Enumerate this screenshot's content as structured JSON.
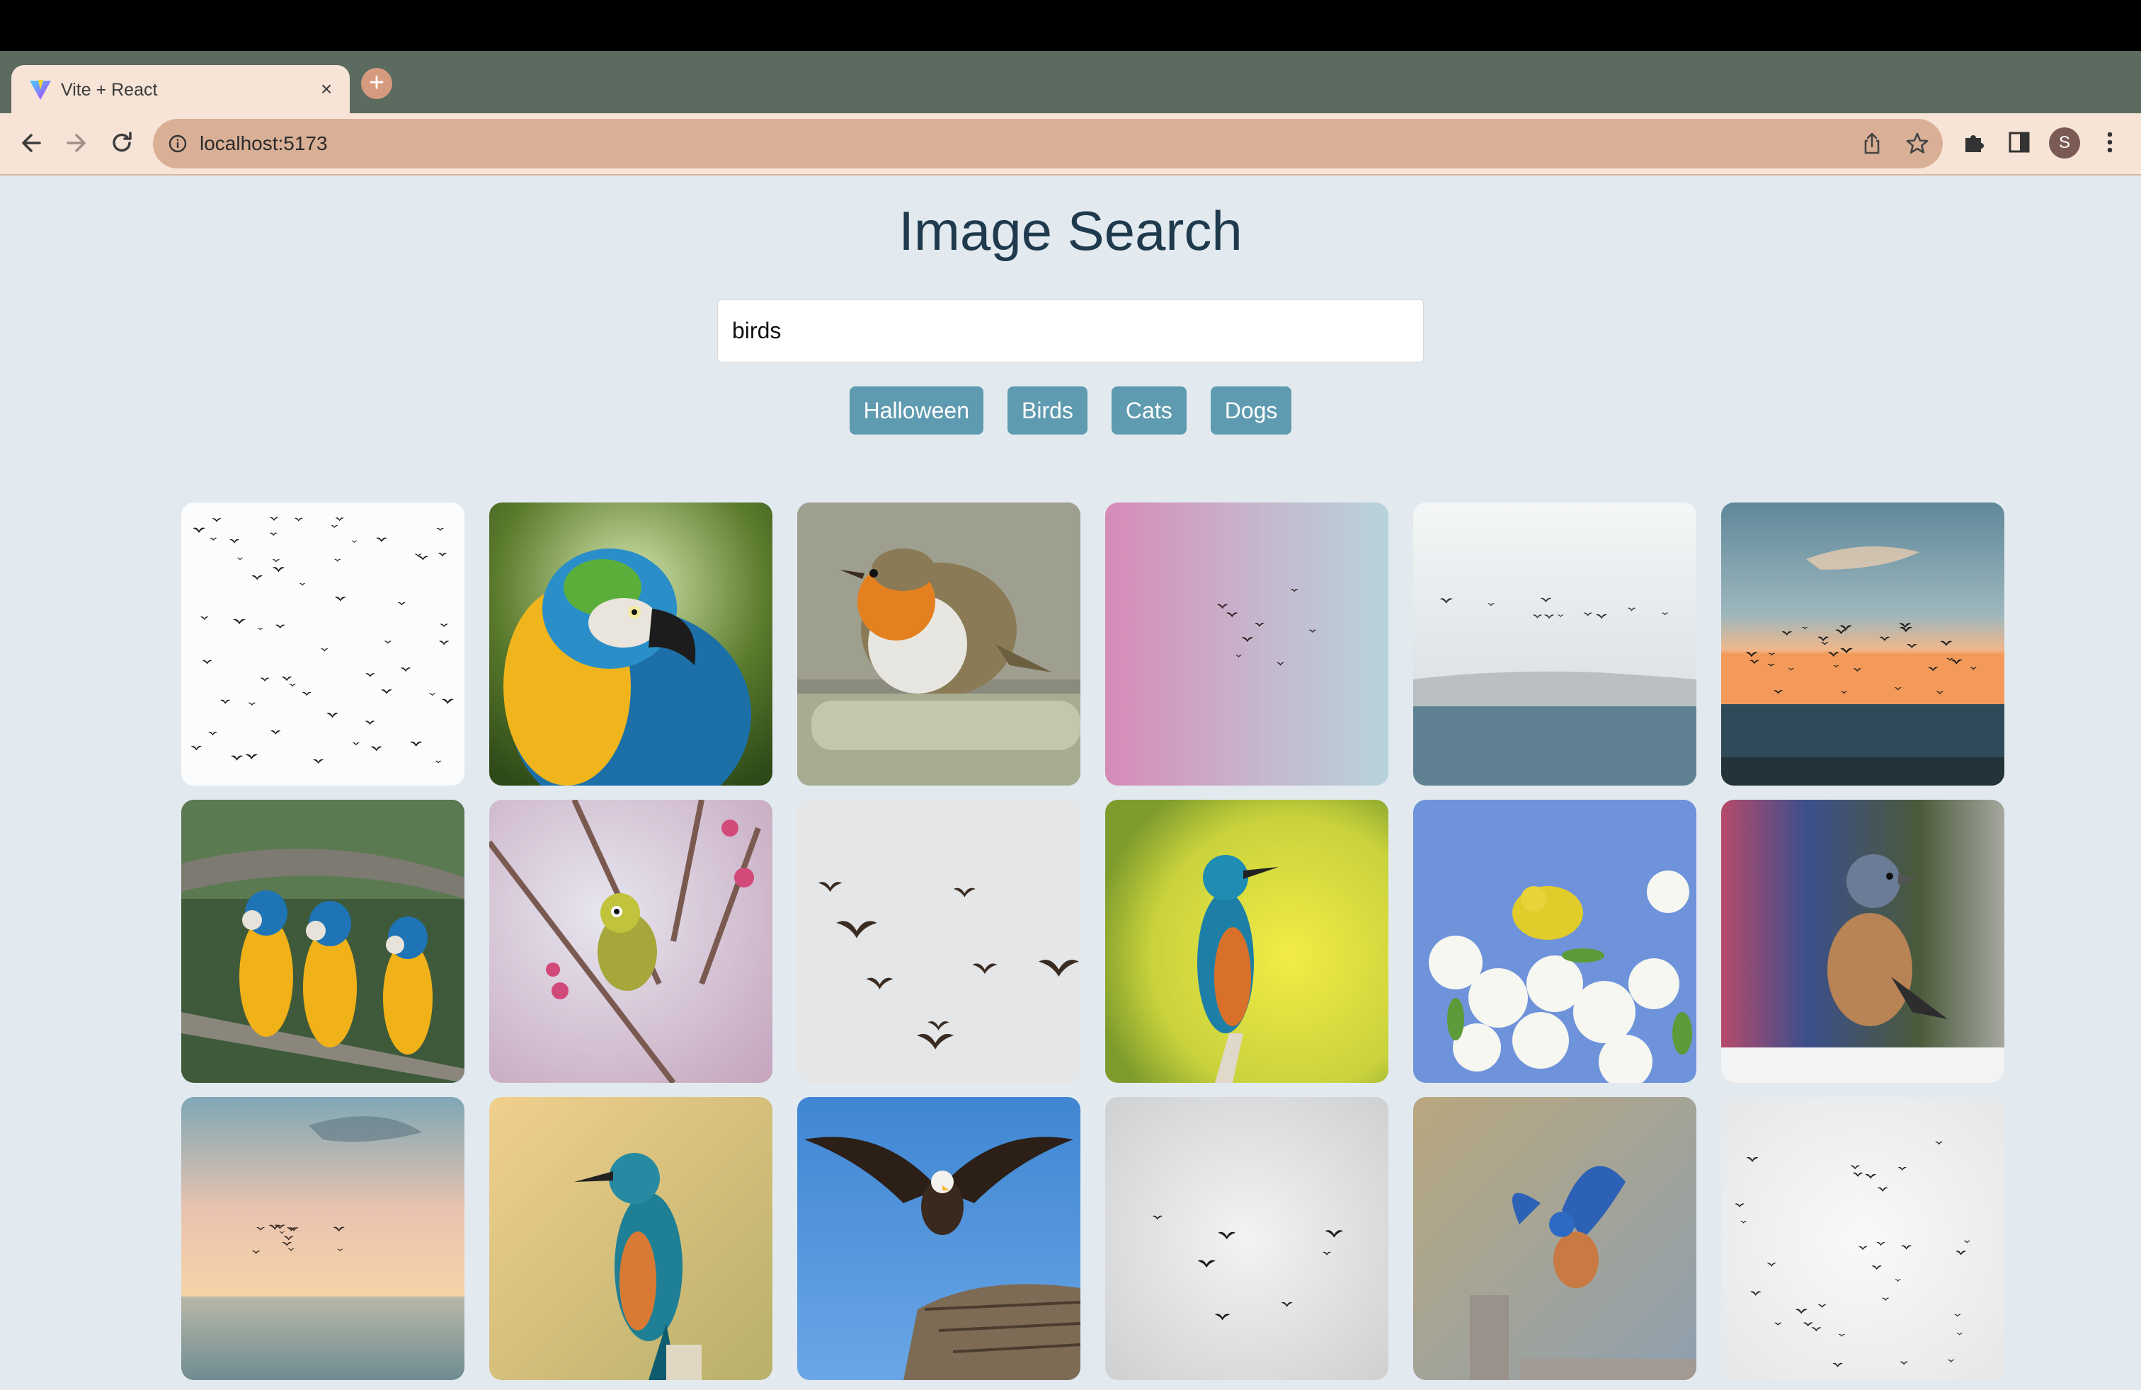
{
  "browser": {
    "tab_title": "Vite + React",
    "close_glyph": "×",
    "new_tab_glyph": "+",
    "url": "localhost:5173",
    "profile_initial": "S",
    "icons": [
      "back-arrow-icon",
      "forward-arrow-icon",
      "reload-icon",
      "site-info-icon",
      "share-icon",
      "bookmark-star-icon",
      "extensions-icon",
      "side-panel-icon",
      "more-menu-icon"
    ]
  },
  "page": {
    "heading": "Image Search",
    "search_value": "birds",
    "quick_searches": [
      "Halloween",
      "Birds",
      "Cats",
      "Dogs"
    ]
  },
  "images": [
    "flock-silhouette-white",
    "blue-yellow-macaw",
    "european-robin",
    "birds-pink-sky",
    "birds-over-sea",
    "sunset-sea-flock",
    "three-macaws",
    "white-eye-blossom",
    "geese-flying",
    "kingfisher-yellow",
    "yellow-warbler-flowers",
    "chaffinch",
    "sunset-sea-birds",
    "kingfisher-perch",
    "eagle-nest",
    "birds-grey-sky",
    "bluebird-post",
    "flock-white-sky"
  ],
  "colors": {
    "page_bg": "#e2eaf0",
    "heading": "#1f3a4d",
    "chip_bg": "#5f9bb0",
    "toolbar_bg": "#f7e4d6",
    "omnibox_bg": "#d9b096",
    "tabstrip_bg": "#5b6b5f"
  }
}
